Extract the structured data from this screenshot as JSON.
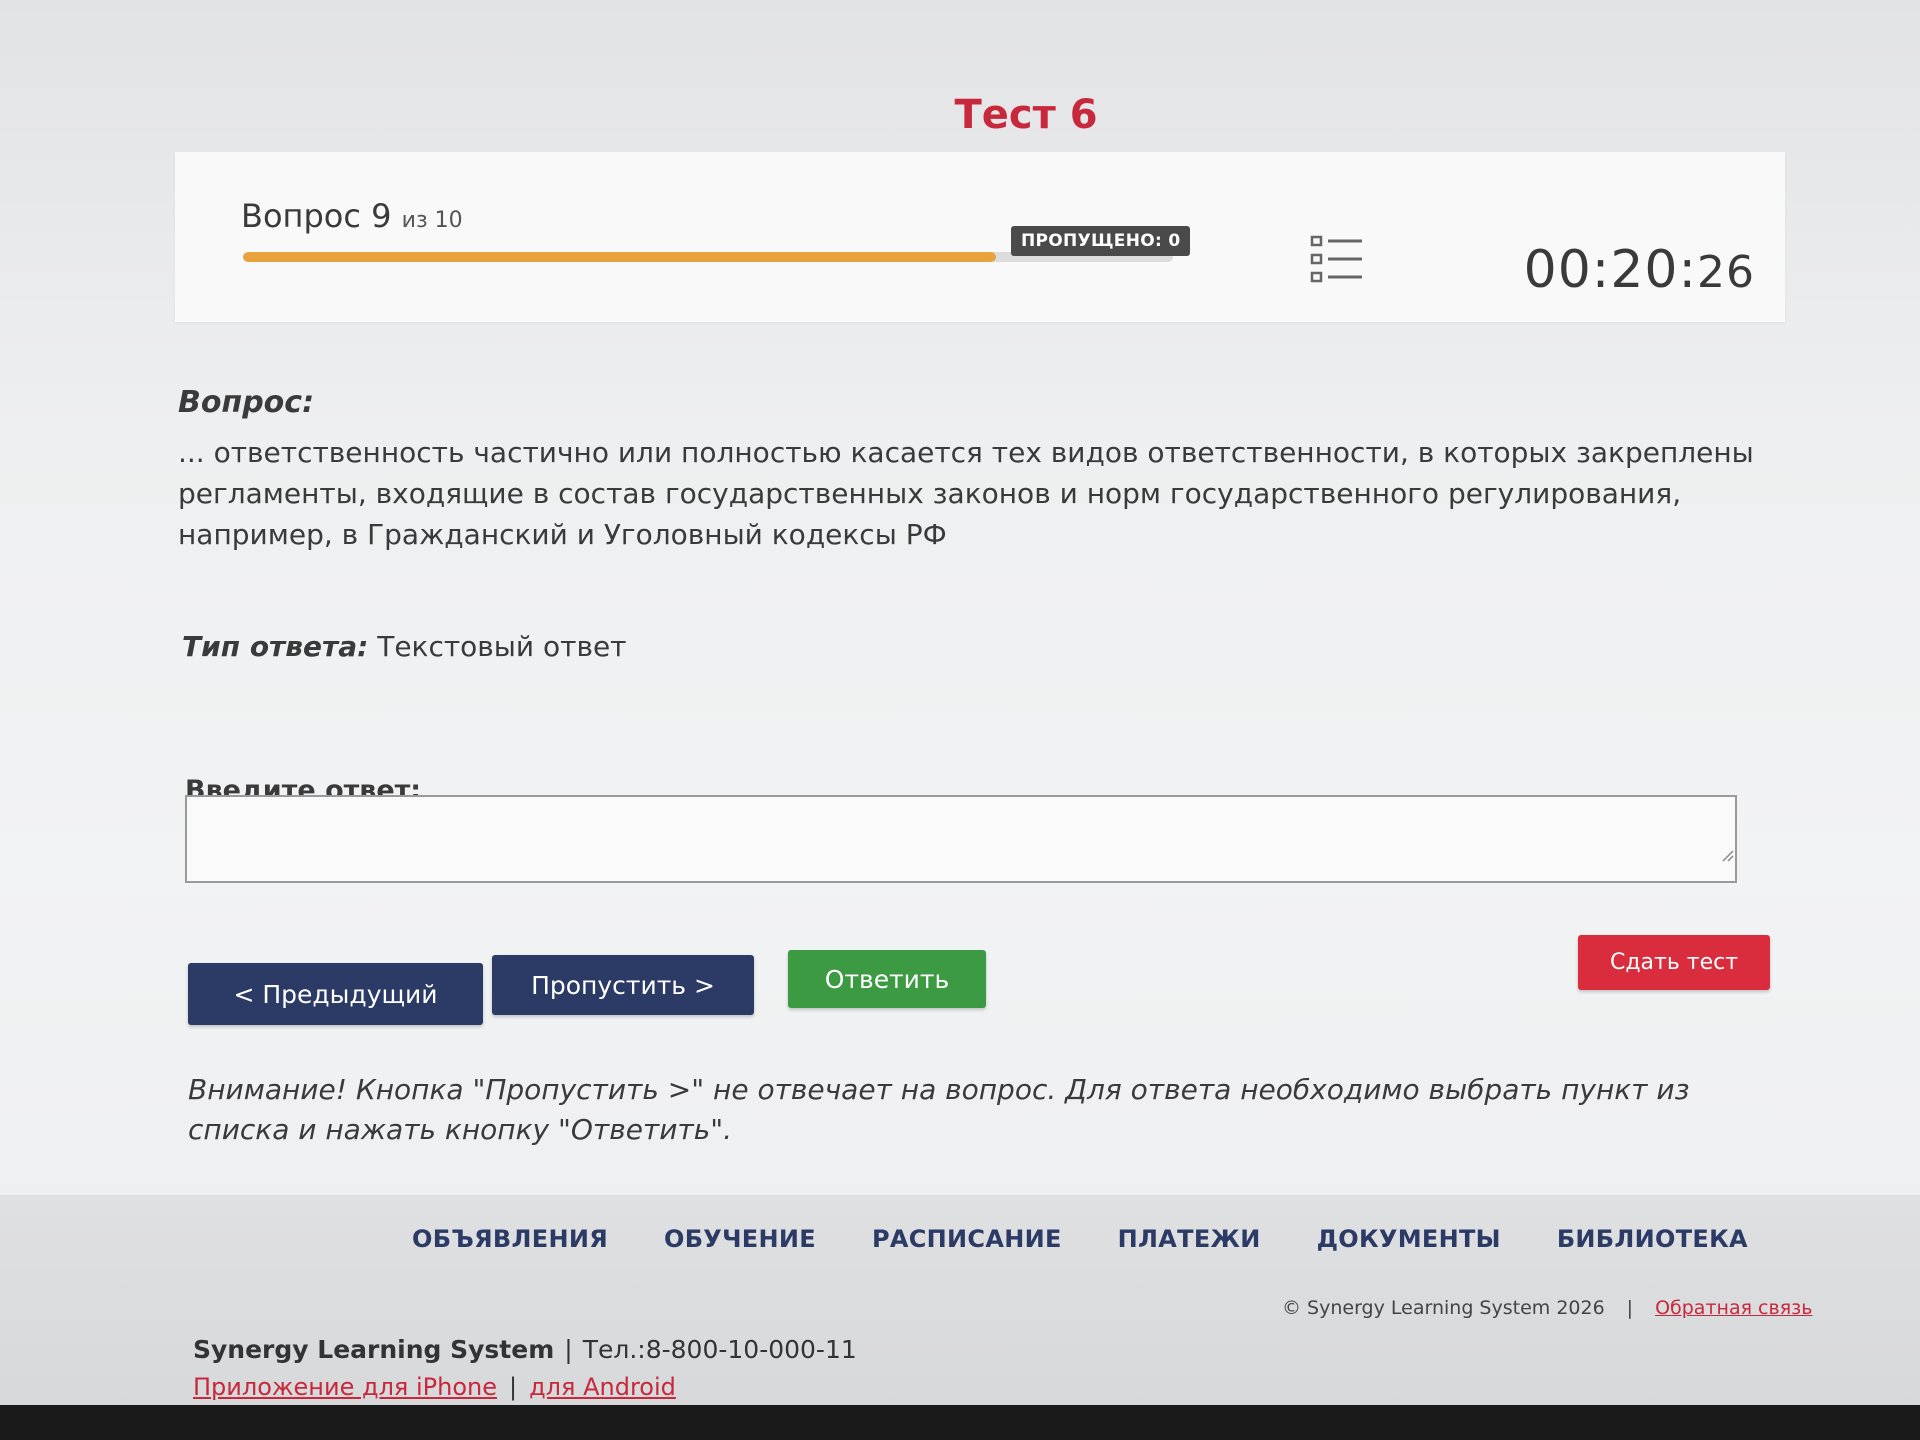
{
  "title": "Тест 6",
  "progress": {
    "question_word": "Вопрос",
    "current": "9",
    "of_text": "из 10",
    "fraction": 0.81,
    "skipped_label": "ПРОПУЩЕНО: 0",
    "timer_main": "00:20:",
    "timer_sec": "26",
    "list_icon": "list-icon"
  },
  "question": {
    "label": "Вопрос:",
    "text": "... ответственность частично или полностью касается тех видов ответственности, в которых закреплены регламенты, входящие в состав государственных законов и норм государственного регулирования, например, в Гражданский и Уголовный кодексы РФ",
    "answer_type_label": "Тип ответа:",
    "answer_type_value": "Текстовый ответ"
  },
  "answer": {
    "label": "Введите ответ:",
    "value": ""
  },
  "buttons": {
    "prev": "< Предыдущий",
    "skip": "Пропустить >",
    "answer": "Ответить",
    "submit": "Сдать тест"
  },
  "warning": "Внимание! Кнопка \"Пропустить >\" не отвечает на вопрос. Для ответа необходимо выбрать пункт из списка и нажать кнопку \"Ответить\".",
  "footer": {
    "nav": [
      "ОБЪЯВЛЕНИЯ",
      "ОБУЧЕНИЕ",
      "РАСПИСАНИЕ",
      "ПЛАТЕЖИ",
      "ДОКУМЕНТЫ",
      "БИБЛИОТЕКА"
    ],
    "copyright": "© Synergy Learning System 2026",
    "feedback": "Обратная связь",
    "brand": "Synergy Learning System",
    "phone": "Тел.:8-800-10-000-11",
    "app_iphone": "Приложение для iPhone",
    "app_android": "для Android"
  },
  "colors": {
    "accent_red": "#c8283c",
    "navy": "#2c3a66",
    "green": "#3c9a43",
    "progress": "#e8a33c"
  }
}
